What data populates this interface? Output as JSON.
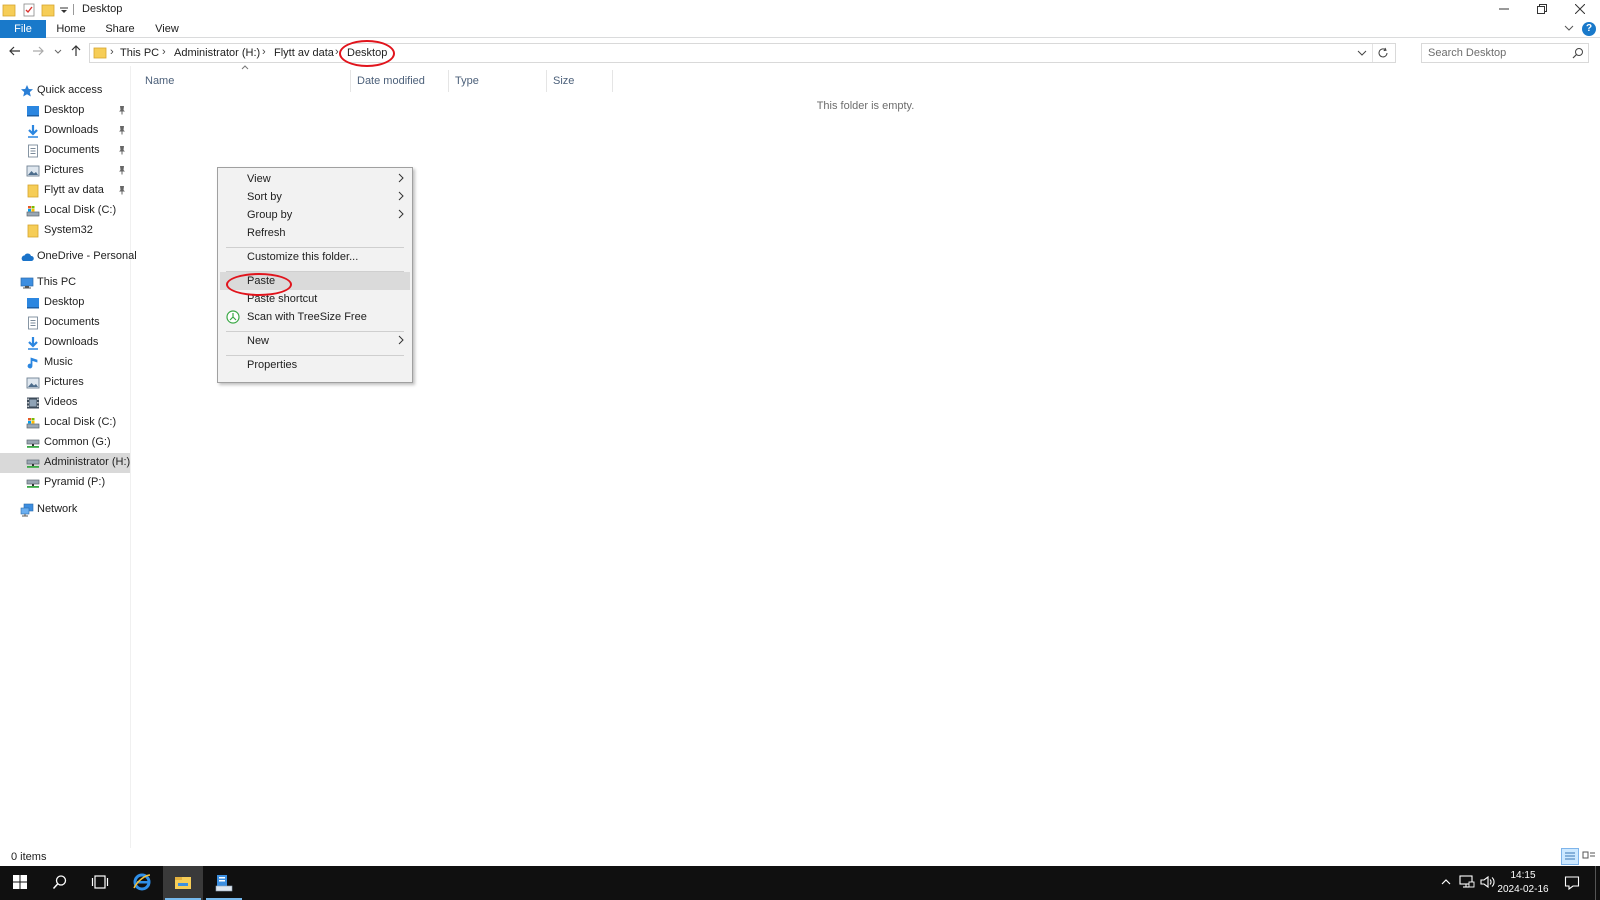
{
  "window": {
    "title": "Desktop"
  },
  "ribbon": {
    "tabs": [
      "File",
      "Home",
      "Share",
      "View"
    ],
    "help": "?"
  },
  "address": {
    "crumbs": [
      "This PC",
      "Administrator (H:)",
      "Flytt av data",
      "Desktop"
    ]
  },
  "search": {
    "placeholder": "Search Desktop"
  },
  "sidebar": {
    "quick_access": {
      "label": "Quick access",
      "items": [
        {
          "label": "Desktop",
          "icon": "desktop-icon",
          "pinned": true
        },
        {
          "label": "Downloads",
          "icon": "downloads-icon",
          "pinned": true
        },
        {
          "label": "Documents",
          "icon": "documents-icon",
          "pinned": true
        },
        {
          "label": "Pictures",
          "icon": "pictures-icon",
          "pinned": true
        },
        {
          "label": "Flytt av data",
          "icon": "folder-icon",
          "pinned": true
        },
        {
          "label": "Local Disk (C:)",
          "icon": "local-disk-icon",
          "pinned": false
        },
        {
          "label": "System32",
          "icon": "folder-icon",
          "pinned": false
        }
      ]
    },
    "onedrive": {
      "label": "OneDrive - Personal"
    },
    "this_pc": {
      "label": "This PC",
      "items": [
        {
          "label": "Desktop",
          "icon": "desktop-icon"
        },
        {
          "label": "Documents",
          "icon": "documents-icon"
        },
        {
          "label": "Downloads",
          "icon": "downloads-icon"
        },
        {
          "label": "Music",
          "icon": "music-icon"
        },
        {
          "label": "Pictures",
          "icon": "pictures-icon"
        },
        {
          "label": "Videos",
          "icon": "videos-icon"
        },
        {
          "label": "Local Disk (C:)",
          "icon": "local-disk-icon"
        },
        {
          "label": "Common (G:)",
          "icon": "network-drive-icon"
        },
        {
          "label": "Administrator (H:)",
          "icon": "network-drive-icon",
          "selected": true
        },
        {
          "label": "Pyramid (P:)",
          "icon": "network-drive-icon"
        }
      ]
    },
    "network": {
      "label": "Network"
    }
  },
  "content": {
    "columns": [
      "Name",
      "Date modified",
      "Type",
      "Size"
    ],
    "empty_message": "This folder is empty."
  },
  "context_menu": {
    "items": {
      "view": "View",
      "sort_by": "Sort by",
      "group_by": "Group by",
      "refresh": "Refresh",
      "customize": "Customize this folder...",
      "paste": "Paste",
      "paste_shortcut": "Paste shortcut",
      "scan_treesize": "Scan with TreeSize Free",
      "new": "New",
      "properties": "Properties"
    },
    "highlighted": "Paste"
  },
  "status": {
    "item_count": "0 items"
  },
  "taskbar": {
    "time": "14:15",
    "date": "2024-02-16"
  },
  "colors": {
    "accent": "#1979ca",
    "annotation": "#e1141c",
    "taskbar": "#101010",
    "selection": "#d9d9d9"
  }
}
